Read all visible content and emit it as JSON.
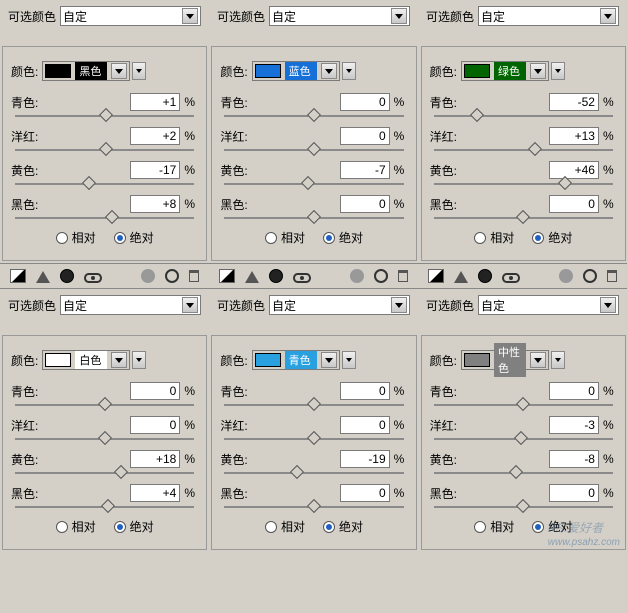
{
  "labels": {
    "selective_color": "可选颜色",
    "preset_custom": "自定",
    "color": "颜色:",
    "cyan": "青色:",
    "magenta": "洋红:",
    "yellow": "黄色:",
    "black": "黑色:",
    "pct": "%",
    "relative": "相对",
    "absolute": "绝对"
  },
  "top": [
    {
      "name": "黑色",
      "bg": "#000000",
      "light": false,
      "c": "+1",
      "m": "+2",
      "y": "-17",
      "k": "+8"
    },
    {
      "name": "蓝色",
      "bg": "#1670d8",
      "light": false,
      "c": "0",
      "m": "0",
      "y": "-7",
      "k": "0"
    },
    {
      "name": "绿色",
      "bg": "#006400",
      "light": false,
      "c": "-52",
      "m": "+13",
      "y": "+46",
      "k": "0"
    }
  ],
  "bottom": [
    {
      "name": "白色",
      "bg": "#ffffff",
      "light": true,
      "c": "0",
      "m": "0",
      "y": "+18",
      "k": "+4"
    },
    {
      "name": "青色",
      "bg": "#29a0e0",
      "light": false,
      "c": "0",
      "m": "0",
      "y": "-19",
      "k": "0"
    },
    {
      "name": "中性色",
      "bg": "#808080",
      "light": false,
      "c": "0",
      "m": "-3",
      "y": "-8",
      "k": "0"
    }
  ],
  "watermark": {
    "main": "PS.爱好者",
    "url": "www.psahz.com"
  }
}
